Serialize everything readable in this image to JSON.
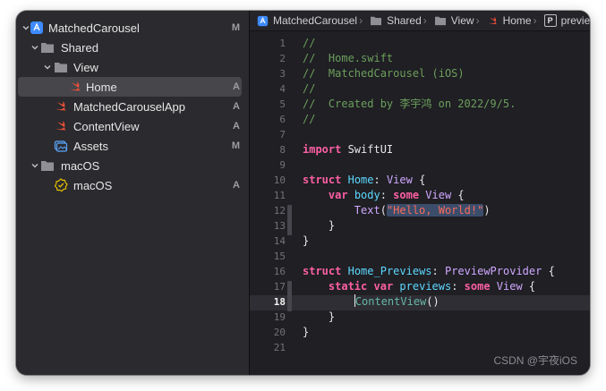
{
  "colors": {
    "sidebar_bg": "#2b2a2e",
    "editor_bg": "#1f1f24",
    "keyword": "#fc5fa3",
    "type": "#5dd8ff",
    "comment": "#6c9f5b",
    "string": "#fc6a5d",
    "swift_icon": "#f05138",
    "folder_icon": "#8f8f95",
    "project_icon": "#3d8bff"
  },
  "navigator": {
    "items": [
      {
        "label": "MatchedCarousel",
        "badge": "M",
        "icon": "project-icon"
      },
      {
        "label": "Shared",
        "badge": "",
        "icon": "folder-icon"
      },
      {
        "label": "View",
        "badge": "",
        "icon": "folder-icon"
      },
      {
        "label": "Home",
        "badge": "A",
        "icon": "swift-file-icon"
      },
      {
        "label": "MatchedCarouselApp",
        "badge": "A",
        "icon": "swift-file-icon"
      },
      {
        "label": "ContentView",
        "badge": "A",
        "icon": "swift-file-icon"
      },
      {
        "label": "Assets",
        "badge": "M",
        "icon": "asset-catalog-icon"
      },
      {
        "label": "macOS",
        "badge": "",
        "icon": "folder-icon"
      },
      {
        "label": "macOS",
        "badge": "A",
        "icon": "entitlements-icon"
      }
    ]
  },
  "breadcrumb": [
    "MatchedCarousel",
    "Shared",
    "View",
    "Home",
    "previe"
  ],
  "editor": {
    "current_line": 18,
    "line_numbers": [
      "1",
      "2",
      "3",
      "4",
      "5",
      "6",
      "7",
      "8",
      "9",
      "10",
      "11",
      "12",
      "13",
      "14",
      "15",
      "16",
      "17",
      "18",
      "19",
      "20",
      "21"
    ],
    "code": {
      "l1": "//",
      "l2": "//  Home.swift",
      "l3": "//  MatchedCarousel (iOS)",
      "l4": "//",
      "l5": "//  Created by 李宇鸿 on 2022/9/5.",
      "l6": "//",
      "import_kw": "import",
      "import_mod": " SwiftUI",
      "struct_kw": "struct",
      "home_name": "Home",
      "colon_view": ": ",
      "view_type": "View",
      "brace_open": " {",
      "indent4": "    ",
      "var_kw": "var",
      "body_name": " body",
      "colon": ": ",
      "some_kw": "some",
      "view_type2": " View",
      "indent8": "        ",
      "text_fn": "Text",
      "paren_open": "(",
      "hello_str": "\"Hello, World!\"",
      "paren_close": ")",
      "close_brace_4": "    }",
      "close_brace": "}",
      "previews_name": "Home_Previews",
      "preview_provider": "PreviewProvider",
      "static_kw": "static",
      "previews_var": "previews",
      "contentview_call": "ContentView",
      "call_parens": "()"
    }
  },
  "watermark": "CSDN @宇夜iOS"
}
